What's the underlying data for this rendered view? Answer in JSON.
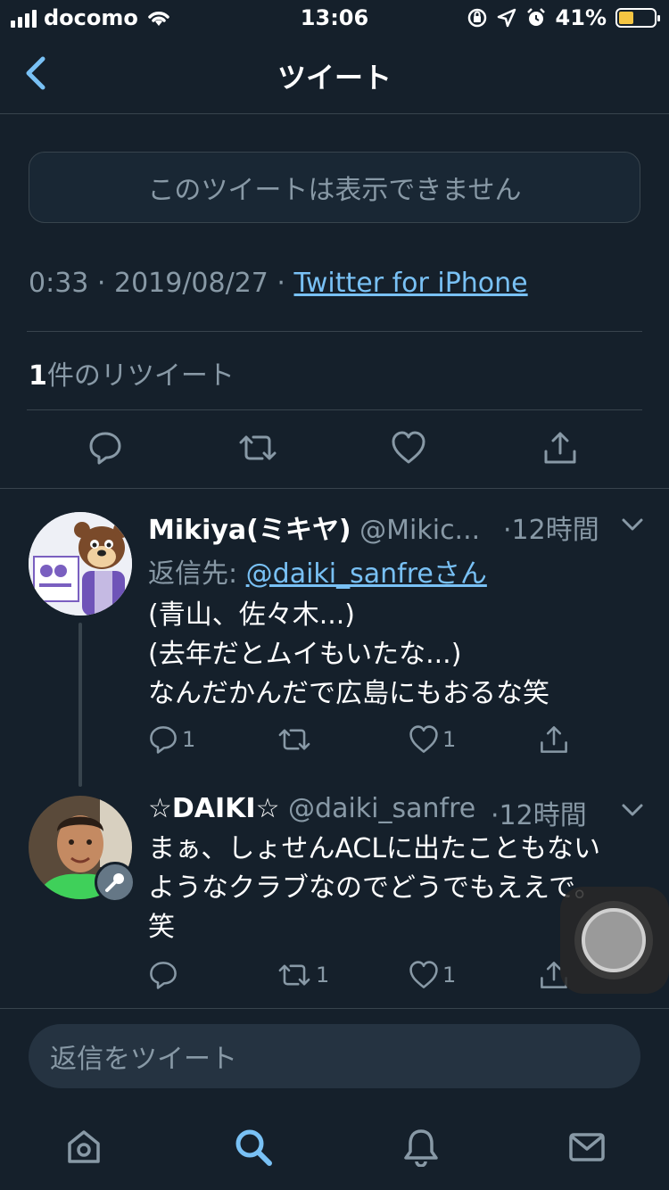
{
  "status_bar": {
    "carrier": "docomo",
    "time": "13:06",
    "battery": "41%",
    "battery_level": 0.41
  },
  "header": {
    "title": "ツイート"
  },
  "main_tweet": {
    "unavailable_message": "このツイートは表示できません",
    "timestamp": "0:33 · 2019/08/27 · ",
    "source": "Twitter for iPhone",
    "retweet_count": "1",
    "retweet_label": "件のリツイート"
  },
  "replies": [
    {
      "name": "Mikiya(ミキヤ)",
      "handle": "@Mikic...",
      "time": "·12時間",
      "reply_to_prefix": "返信先: ",
      "reply_to": "@daiki_sanfreさん",
      "lines": [
        "(青山、佐々木...)",
        "(去年だとムイもいたな...)",
        "なんだかんだで広島にもおるな笑"
      ],
      "reply_count": "1",
      "retweet_count": "",
      "like_count": "1"
    },
    {
      "name": "☆DAIKI☆",
      "handle": "@daiki_sanfre",
      "time": "·12時間",
      "lines": [
        "まぁ、しょせんACLに出たこともない",
        "ようなクラブなのでどうでもええで。",
        "笑"
      ],
      "reply_count": "",
      "retweet_count": "1",
      "like_count": "1"
    }
  ],
  "compose": {
    "placeholder": "返信をツイート"
  },
  "colors": {
    "background": "#15202b",
    "link": "#79c1f5",
    "muted": "#8899a6",
    "border": "#38444d"
  }
}
